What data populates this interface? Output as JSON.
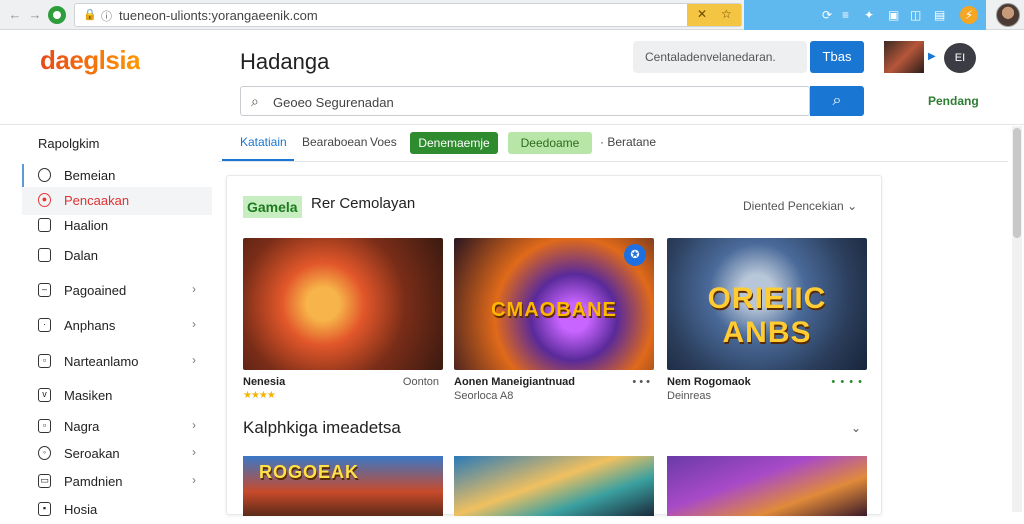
{
  "browser": {
    "back": "←",
    "forward": "→",
    "url": "tueneon-ulionts:yorangaeenik.com",
    "ext_icons": [
      "e-icon",
      "flame-icon",
      "chat-icon",
      "bag-icon",
      "star-icon"
    ]
  },
  "header": {
    "logo": "daeglsia",
    "title": "Hadanga",
    "top_search_text": "Centaladenvelanedaran.",
    "top_button": "Tbas",
    "thumb_label": "EI",
    "search_placeholder": "Geoeo Segurenadan",
    "link": "Pendang"
  },
  "sidebar": {
    "title": "Rapolgkim",
    "items": [
      {
        "label": "Bemeian",
        "icon": "circle-icon",
        "chevron": ""
      },
      {
        "label": "Pencaakan",
        "icon": "target-icon",
        "chevron": ""
      },
      {
        "label": "Haalion",
        "icon": "folder-icon",
        "chevron": ""
      },
      {
        "label": "Dalan",
        "icon": "file-icon",
        "chevron": ""
      },
      {
        "label": "Pagoained",
        "icon": "box-icon",
        "chevron": "›"
      },
      {
        "label": "Anphans",
        "icon": "box-icon",
        "chevron": "›"
      },
      {
        "label": "Narteanlamo",
        "icon": "box-icon",
        "chevron": "›"
      },
      {
        "label": "Masiken",
        "icon": "shield-icon",
        "chevron": ""
      },
      {
        "label": "Nagra",
        "icon": "box-icon",
        "chevron": "›"
      },
      {
        "label": "Seroakan",
        "icon": "chat-icon",
        "chevron": "›"
      },
      {
        "label": "Pamdnien",
        "icon": "box-icon",
        "chevron": "›"
      },
      {
        "label": "Hosia",
        "icon": "box-icon",
        "chevron": ""
      }
    ]
  },
  "tabs": {
    "items": [
      "Katatiain",
      "Bearaboean",
      "Voes",
      "Denemaemje",
      "Deedoame",
      "· Beratane"
    ]
  },
  "section1": {
    "badge": "Gamela",
    "title": "Rer Cemolayan",
    "right": "Diented Pencekian ⌄",
    "cards": [
      {
        "overlay": "",
        "name": "Nenesia",
        "right": "Oonton",
        "rating": "★★★★",
        "sub": ""
      },
      {
        "overlay": "CMAOBANE",
        "name": "Aonen Maneigiantnuad",
        "right": "• • •",
        "rating": "",
        "sub": "Seorloca  A8"
      },
      {
        "overlay": "ORIEIIC ANBS",
        "name": "Nem Rogomaok",
        "right": "• • • •",
        "rating": "",
        "sub": "Deinreas"
      }
    ]
  },
  "section2": {
    "title": "Kalphkiga imeadetsa",
    "chevron": "⌄",
    "cards": [
      {
        "overlay": "ROGOEAK"
      },
      {
        "overlay": ""
      },
      {
        "overlay": ""
      }
    ]
  },
  "colors": {
    "accent_blue": "#1976d2",
    "green": "#2e8b2e",
    "active_red": "#d33"
  }
}
